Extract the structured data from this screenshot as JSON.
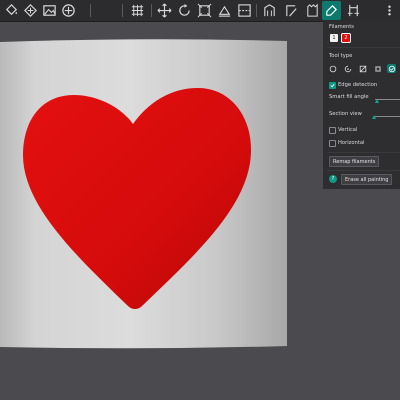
{
  "colors": {
    "accent": "#0e9a86",
    "toolbar_bg": "#2c2c2f",
    "panel_bg": "#2e2e31",
    "viewport_bg": "#4b4b4f",
    "heart": "#e00d0d",
    "mug": "#d6d6d6"
  },
  "toolbar": {
    "icons": [
      "paint-bucket-icon",
      "move-3d-icon",
      "image-icon",
      "plus-circle-icon",
      "grid-icon",
      "move-icon",
      "rotate-icon",
      "scale-icon",
      "place-on-face-icon",
      "cut-icon",
      "support-paint-icon",
      "seam-paint-icon",
      "fuzzy-skin-icon",
      "color-paint-icon",
      "measure-icon",
      "more-icon"
    ]
  },
  "panel": {
    "filaments_label": "Filaments",
    "filaments": [
      "1",
      "2"
    ],
    "tool_type_label": "Tool type",
    "tool_types": [
      "circle-brush-icon",
      "sphere-brush-icon",
      "fill-icon",
      "gap-fill-icon",
      "smart-fill-icon"
    ],
    "edge_detection_label": "Edge detection",
    "edge_detection_checked": true,
    "smart_fill_angle_label": "Smart fill angle",
    "section_view_label": "Section view",
    "vertical_label": "Vertical",
    "horizontal_label": "Horizontal",
    "remap_filaments_label": "Remap filaments",
    "erase_all_painting_label": "Erase all painting",
    "help_icon_text": "?"
  }
}
